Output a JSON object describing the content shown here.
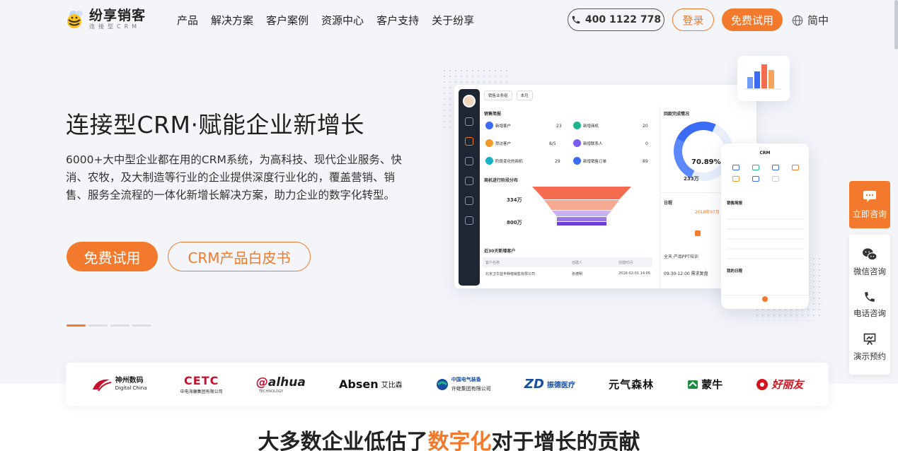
{
  "header": {
    "logo_name": "纷享销客",
    "logo_sub": "连接型CRM",
    "nav": [
      "产品",
      "解决方案",
      "客户案例",
      "资源中心",
      "客户支持",
      "关于纷享"
    ],
    "phone": "400 1122 778",
    "login": "登录",
    "trial": "免费试用",
    "language": "简中"
  },
  "hero": {
    "title": "连接型CRM·赋能企业新增长",
    "description": "6000+大中型企业都在用的CRM系统，为高科技、现代企业服务、快消、农牧，及大制造等行业的企业提供深度行业化的，覆盖营销、销售、服务全流程的一体化新增长解决方案，助力企业的数字化转型。",
    "primary_button": "免费试用",
    "secondary_button": "CRM产品白皮书"
  },
  "dashboard": {
    "filter1": "销售业务组",
    "filter2": "本月",
    "section1": "销售简报",
    "stats": [
      {
        "label": "新增客户",
        "value": "23",
        "color": "#3b6bf5"
      },
      {
        "label": "新增商机",
        "value": "20",
        "color": "#1fb58f"
      },
      {
        "label": "拜访客户",
        "value": "8/5",
        "color": "#f39a2c"
      },
      {
        "label": "新增联系人",
        "value": "0",
        "color": "#7b5cf0"
      },
      {
        "label": "阶段变化的商机",
        "value": "29",
        "color": "#19b1c6"
      },
      {
        "label": "新增销售订单",
        "value": "89",
        "color": "#3b6bf5"
      }
    ],
    "section2": "商机进行阶段分布",
    "funnel_value1": "334万",
    "funnel_value2": "800万",
    "gauge_title": "回款完成情况",
    "gauge_value": "70.89%",
    "gauge_stat": "233万",
    "calendar_title": "日程",
    "calendar_month": "2018年07月",
    "event1": "全天  产品PPT培训",
    "event2": "09:30-12:00  需求复盘",
    "section3": "近30天新增客户",
    "table_headers": [
      "客户名称",
      "创建人",
      "创建时间"
    ],
    "table_row": [
      "北京卫华益丰种植销售有限公司",
      "张德明",
      "2016-02-01 14:05"
    ]
  },
  "phone_mock": {
    "title": "CRM",
    "section": "销售简报",
    "section2": "我的日程"
  },
  "float_panel": {
    "consult": "立即咨询",
    "wechat": "微信咨询",
    "phone": "电话咨询",
    "demo": "演示预约"
  },
  "logos": [
    {
      "name": "神州数码",
      "sub": "Digital China",
      "color": "#c8102e"
    },
    {
      "name": "CETC",
      "sub": "中电海康集团有限公司",
      "color": "#c8102e"
    },
    {
      "name": "alhua",
      "sub": "TECHNOLOGY",
      "color": "#c8102e"
    },
    {
      "name": "Absen",
      "sub": "艾比森",
      "color": "#111111"
    },
    {
      "name": "中国电气装备",
      "sub": "许继集团有限公司",
      "color": "#1a4fa0"
    },
    {
      "name": "ZD",
      "sub": "振德医疗",
      "color": "#1a4fa0"
    },
    {
      "name": "元气森林",
      "sub": "",
      "color": "#111111"
    },
    {
      "name": "蒙牛",
      "sub": "",
      "color": "#1c8d3e"
    },
    {
      "name": "好丽友",
      "sub": "",
      "color": "#d4141e"
    }
  ],
  "section": {
    "title_pre": "大多数企业低估了",
    "title_highlight": "数字化",
    "title_post": "对于增长的贡献"
  }
}
